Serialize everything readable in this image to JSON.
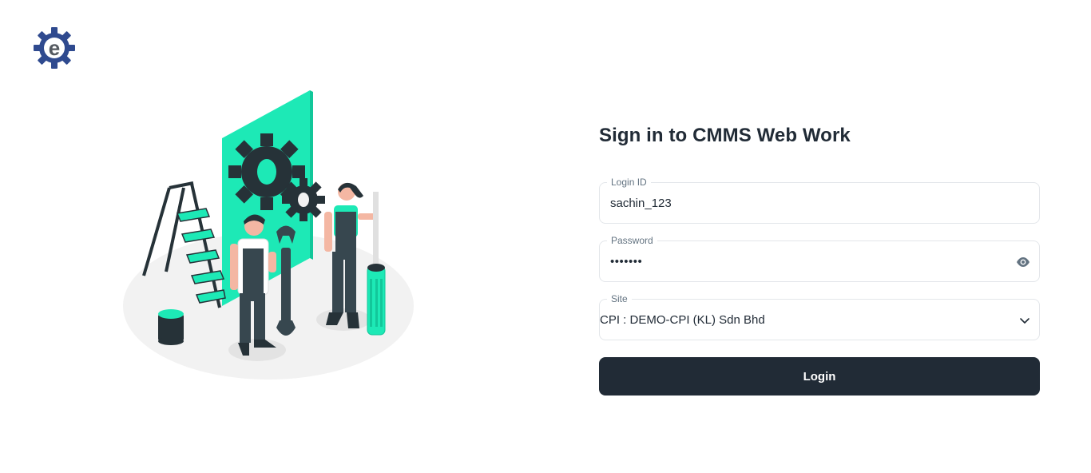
{
  "app": {
    "logo_letter": "e"
  },
  "form": {
    "title": "Sign in to CMMS Web Work",
    "login_id": {
      "label": "Login ID",
      "value": "sachin_123"
    },
    "password": {
      "label": "Password",
      "value": "•••••••",
      "toggle_icon": "eye-icon"
    },
    "site": {
      "label": "Site",
      "value": "CPI : DEMO-CPI (KL) Sdn Bhd",
      "dropdown_icon": "chevron-down-icon"
    },
    "submit_label": "Login"
  },
  "colors": {
    "primary_dark": "#212b36",
    "accent_teal": "#1de9b6",
    "logo_blue": "#2f4a8f",
    "border": "#e3e6ea",
    "label_grey": "#637381"
  }
}
